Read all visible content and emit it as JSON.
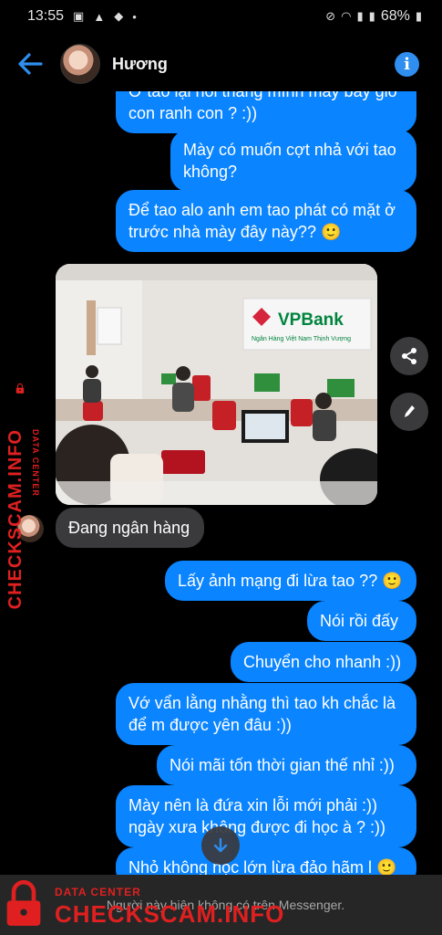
{
  "status_bar": {
    "time": "13:55",
    "battery": "68%"
  },
  "header": {
    "contact_name": "Hương"
  },
  "messages": [
    {
      "direction": "out",
      "text": "Ở tao lại nói thằng mình mày bảy giờ con ranh con ? :))"
    },
    {
      "direction": "out",
      "text": "Mày có muốn cợt nhả với tao không?"
    },
    {
      "direction": "out",
      "text": "Để tao alo anh em tao phát có mặt ở trước nhà mày đây này?? 🙂"
    },
    {
      "direction": "in",
      "type": "photo",
      "photo_sign": "VPBank",
      "photo_subtitle": "Ngân Hàng Việt Nam Thịnh Vượng"
    },
    {
      "direction": "in",
      "text": "Đang ngân hàng"
    },
    {
      "direction": "out",
      "text": "Lấy ảnh mạng đi lừa tao ?? 🙂"
    },
    {
      "direction": "out",
      "text": "Nói rồi đấy"
    },
    {
      "direction": "out",
      "text": "Chuyển cho nhanh :))"
    },
    {
      "direction": "out",
      "text": "Vớ vẩn lằng nhằng thì tao kh chắc là để m được yên đâu :))"
    },
    {
      "direction": "out",
      "text": "Nói mãi tốn thời gian thế nhỉ :))"
    },
    {
      "direction": "out",
      "text": "Mày nên là đứa xin lỗi mới phải :)) ngày xưa không được đi học à ? :))"
    },
    {
      "direction": "out",
      "text": "Nhỏ không nọc lớn lừa đảo hãm l 🙂"
    }
  ],
  "footer": {
    "notice": "Người này hiện không có trên Messenger."
  },
  "watermark": {
    "small": "DATA CENTER",
    "big": "CHECKSCAM.INFO"
  },
  "colors": {
    "background": "#000000",
    "outgoing_bubble": "#0a84ff",
    "incoming_bubble": "#3a3a3c",
    "accent": "#2f8ef0",
    "watermark": "#e02020"
  }
}
